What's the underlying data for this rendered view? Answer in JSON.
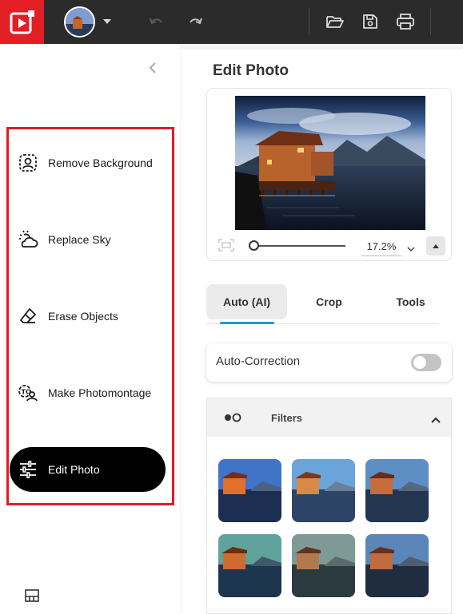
{
  "topbar": {
    "logo_icon": "app-logo-icon",
    "avatar_icon": "photo-avatar",
    "undo_icon": "undo-icon",
    "redo_icon": "redo-icon",
    "open_icon": "folder-open-icon",
    "save_icon": "save-icon",
    "print_icon": "print-icon"
  },
  "sidebar": {
    "tools": [
      {
        "label": "Remove Background",
        "icon": "person-frame-icon"
      },
      {
        "label": "Replace Sky",
        "icon": "sun-cloud-icon"
      },
      {
        "label": "Erase Objects",
        "icon": "eraser-icon"
      },
      {
        "label": "Make Photomontage",
        "icon": "photomontage-icon"
      },
      {
        "label": "Edit Photo",
        "icon": "sliders-icon",
        "active": true
      }
    ]
  },
  "panel": {
    "title": "Edit Photo",
    "zoom": "17.2%",
    "tabs": [
      "Auto (AI)",
      "Crop",
      "Tools"
    ],
    "active_tab": "Auto (AI)",
    "auto_correction": {
      "label": "Auto-Correction",
      "enabled": false
    },
    "filters": {
      "label": "Filters",
      "expanded": true,
      "thumbnail_count": 6
    }
  },
  "colors": {
    "brand_red": "#e31e24",
    "topbar": "#2b2b2b",
    "accent_blue": "#1a9bd7"
  }
}
